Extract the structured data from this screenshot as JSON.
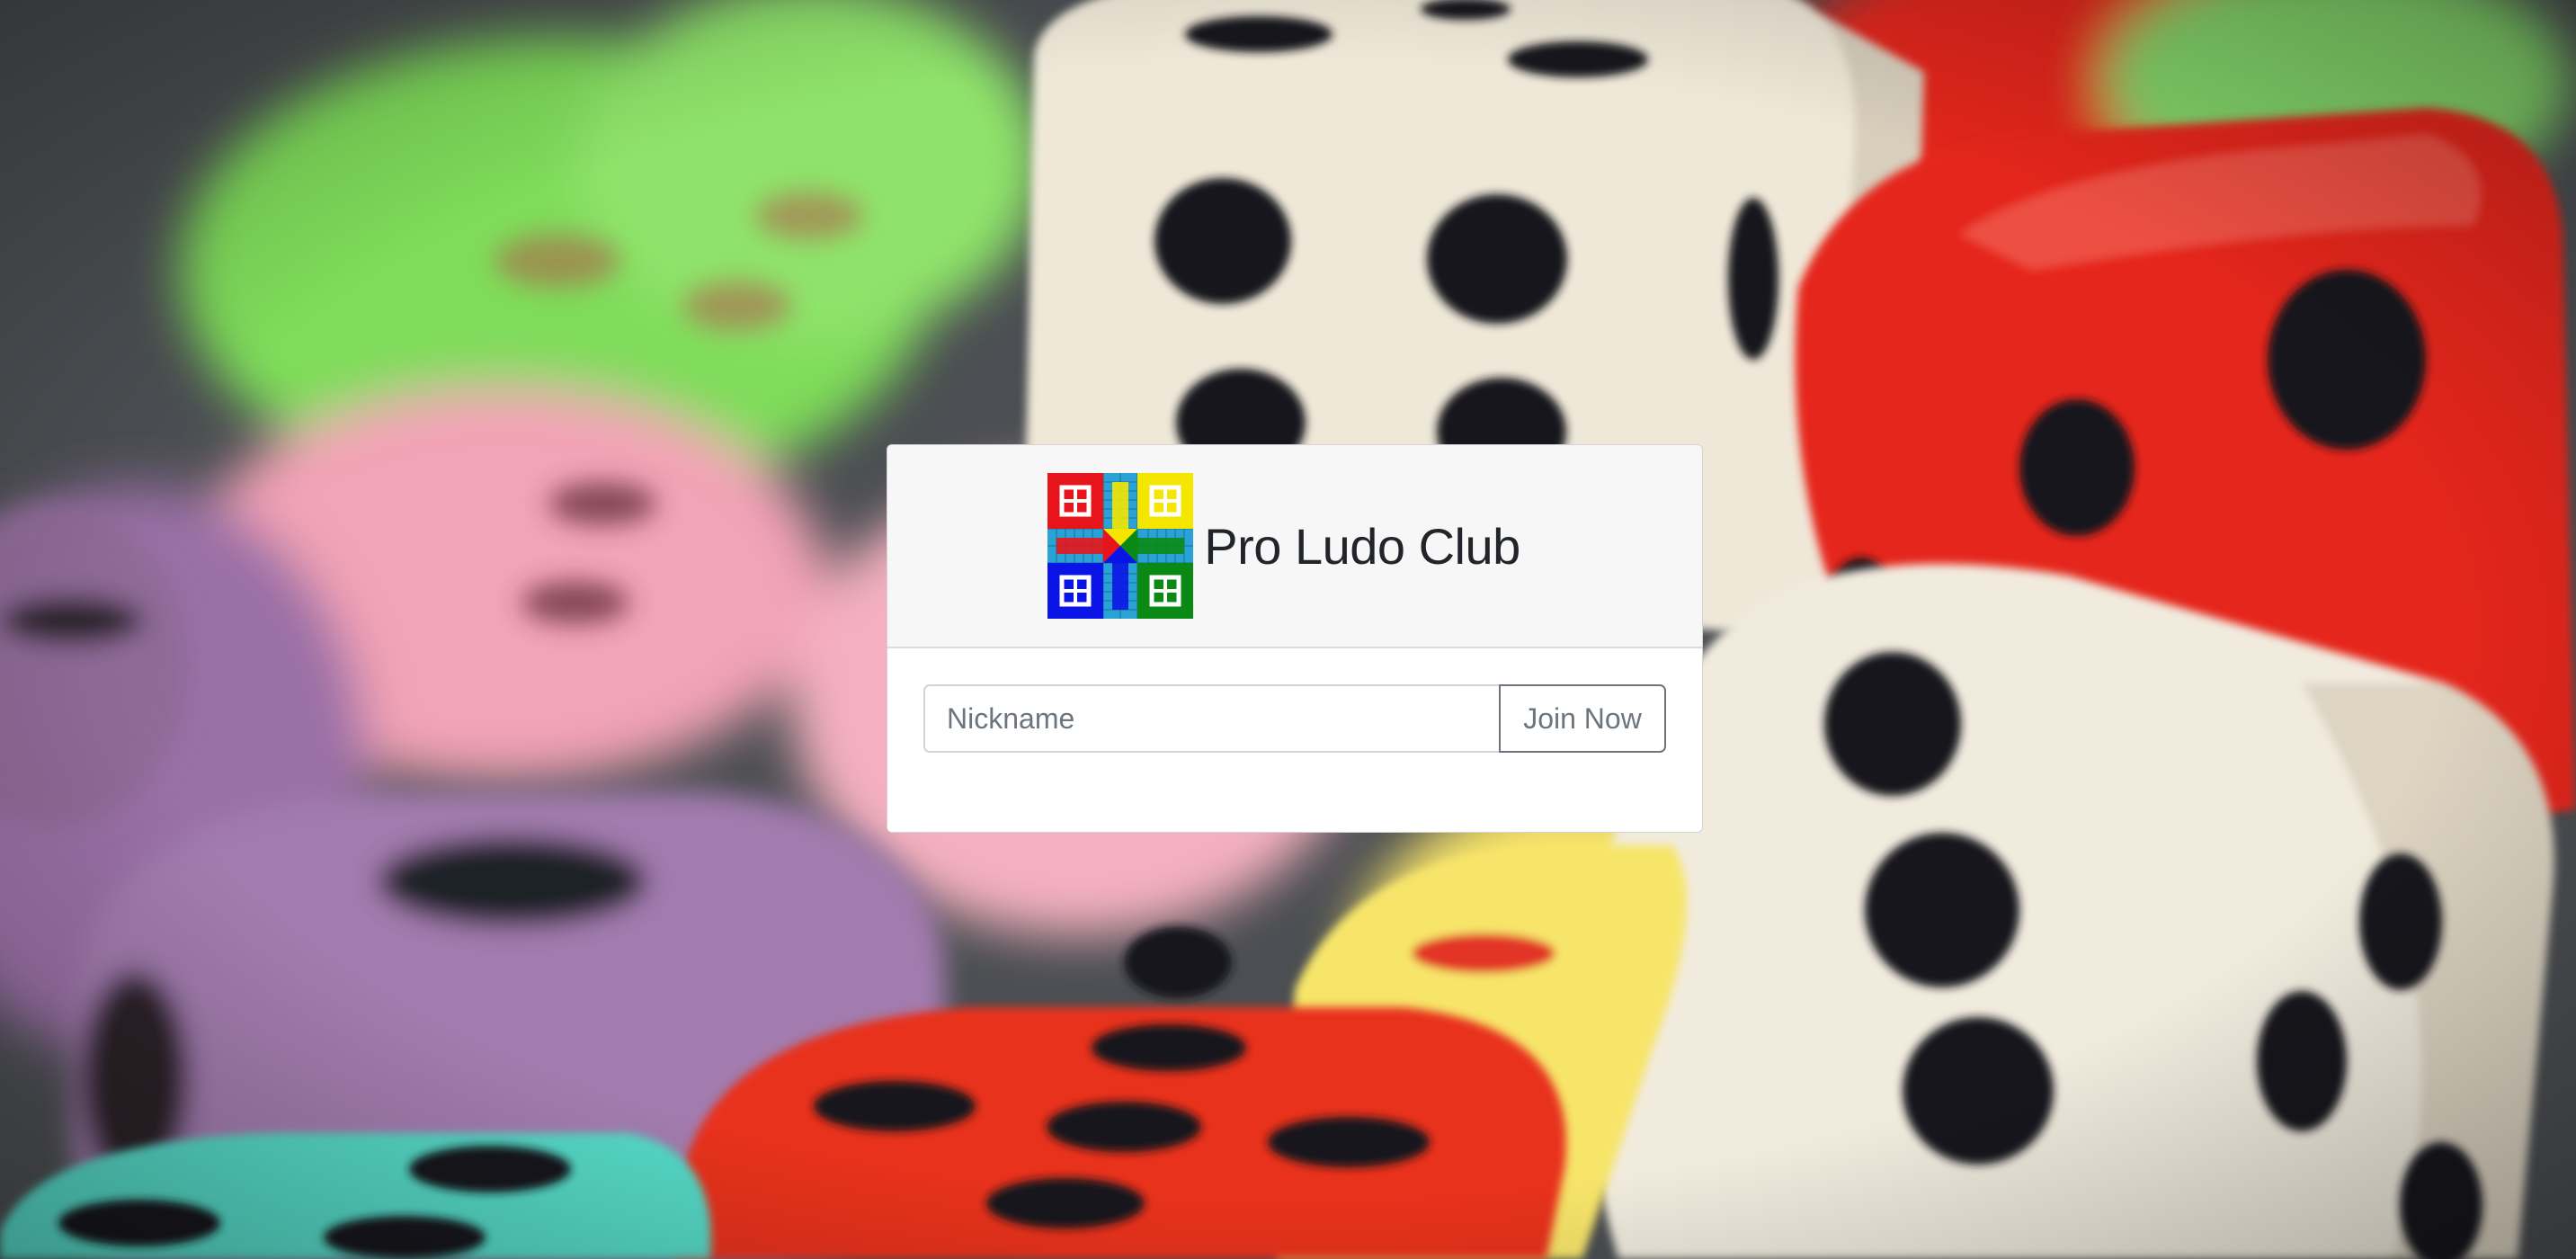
{
  "app": {
    "title": "Pro Ludo Club"
  },
  "background": {
    "image": "colorful-dice-photo"
  },
  "logo": {
    "icon": "ludo-board-icon",
    "colors": {
      "red": "#e8141b",
      "yellow": "#f5e600",
      "blue": "#0a14e6",
      "green": "#0a8a14",
      "track": "#29a3d6"
    }
  },
  "join_form": {
    "nickname_placeholder": "Nickname",
    "nickname_value": "",
    "join_label": "Join Now"
  }
}
